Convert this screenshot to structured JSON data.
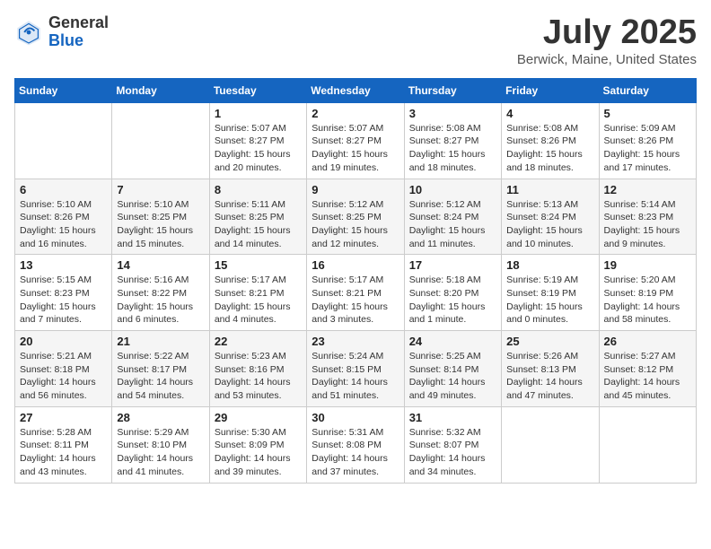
{
  "header": {
    "logo_general": "General",
    "logo_blue": "Blue",
    "title": "July 2025",
    "subtitle": "Berwick, Maine, United States"
  },
  "weekdays": [
    "Sunday",
    "Monday",
    "Tuesday",
    "Wednesday",
    "Thursday",
    "Friday",
    "Saturday"
  ],
  "weeks": [
    [
      {
        "day": "",
        "info": ""
      },
      {
        "day": "",
        "info": ""
      },
      {
        "day": "1",
        "info": "Sunrise: 5:07 AM\nSunset: 8:27 PM\nDaylight: 15 hours and 20 minutes."
      },
      {
        "day": "2",
        "info": "Sunrise: 5:07 AM\nSunset: 8:27 PM\nDaylight: 15 hours and 19 minutes."
      },
      {
        "day": "3",
        "info": "Sunrise: 5:08 AM\nSunset: 8:27 PM\nDaylight: 15 hours and 18 minutes."
      },
      {
        "day": "4",
        "info": "Sunrise: 5:08 AM\nSunset: 8:26 PM\nDaylight: 15 hours and 18 minutes."
      },
      {
        "day": "5",
        "info": "Sunrise: 5:09 AM\nSunset: 8:26 PM\nDaylight: 15 hours and 17 minutes."
      }
    ],
    [
      {
        "day": "6",
        "info": "Sunrise: 5:10 AM\nSunset: 8:26 PM\nDaylight: 15 hours and 16 minutes."
      },
      {
        "day": "7",
        "info": "Sunrise: 5:10 AM\nSunset: 8:25 PM\nDaylight: 15 hours and 15 minutes."
      },
      {
        "day": "8",
        "info": "Sunrise: 5:11 AM\nSunset: 8:25 PM\nDaylight: 15 hours and 14 minutes."
      },
      {
        "day": "9",
        "info": "Sunrise: 5:12 AM\nSunset: 8:25 PM\nDaylight: 15 hours and 12 minutes."
      },
      {
        "day": "10",
        "info": "Sunrise: 5:12 AM\nSunset: 8:24 PM\nDaylight: 15 hours and 11 minutes."
      },
      {
        "day": "11",
        "info": "Sunrise: 5:13 AM\nSunset: 8:24 PM\nDaylight: 15 hours and 10 minutes."
      },
      {
        "day": "12",
        "info": "Sunrise: 5:14 AM\nSunset: 8:23 PM\nDaylight: 15 hours and 9 minutes."
      }
    ],
    [
      {
        "day": "13",
        "info": "Sunrise: 5:15 AM\nSunset: 8:23 PM\nDaylight: 15 hours and 7 minutes."
      },
      {
        "day": "14",
        "info": "Sunrise: 5:16 AM\nSunset: 8:22 PM\nDaylight: 15 hours and 6 minutes."
      },
      {
        "day": "15",
        "info": "Sunrise: 5:17 AM\nSunset: 8:21 PM\nDaylight: 15 hours and 4 minutes."
      },
      {
        "day": "16",
        "info": "Sunrise: 5:17 AM\nSunset: 8:21 PM\nDaylight: 15 hours and 3 minutes."
      },
      {
        "day": "17",
        "info": "Sunrise: 5:18 AM\nSunset: 8:20 PM\nDaylight: 15 hours and 1 minute."
      },
      {
        "day": "18",
        "info": "Sunrise: 5:19 AM\nSunset: 8:19 PM\nDaylight: 15 hours and 0 minutes."
      },
      {
        "day": "19",
        "info": "Sunrise: 5:20 AM\nSunset: 8:19 PM\nDaylight: 14 hours and 58 minutes."
      }
    ],
    [
      {
        "day": "20",
        "info": "Sunrise: 5:21 AM\nSunset: 8:18 PM\nDaylight: 14 hours and 56 minutes."
      },
      {
        "day": "21",
        "info": "Sunrise: 5:22 AM\nSunset: 8:17 PM\nDaylight: 14 hours and 54 minutes."
      },
      {
        "day": "22",
        "info": "Sunrise: 5:23 AM\nSunset: 8:16 PM\nDaylight: 14 hours and 53 minutes."
      },
      {
        "day": "23",
        "info": "Sunrise: 5:24 AM\nSunset: 8:15 PM\nDaylight: 14 hours and 51 minutes."
      },
      {
        "day": "24",
        "info": "Sunrise: 5:25 AM\nSunset: 8:14 PM\nDaylight: 14 hours and 49 minutes."
      },
      {
        "day": "25",
        "info": "Sunrise: 5:26 AM\nSunset: 8:13 PM\nDaylight: 14 hours and 47 minutes."
      },
      {
        "day": "26",
        "info": "Sunrise: 5:27 AM\nSunset: 8:12 PM\nDaylight: 14 hours and 45 minutes."
      }
    ],
    [
      {
        "day": "27",
        "info": "Sunrise: 5:28 AM\nSunset: 8:11 PM\nDaylight: 14 hours and 43 minutes."
      },
      {
        "day": "28",
        "info": "Sunrise: 5:29 AM\nSunset: 8:10 PM\nDaylight: 14 hours and 41 minutes."
      },
      {
        "day": "29",
        "info": "Sunrise: 5:30 AM\nSunset: 8:09 PM\nDaylight: 14 hours and 39 minutes."
      },
      {
        "day": "30",
        "info": "Sunrise: 5:31 AM\nSunset: 8:08 PM\nDaylight: 14 hours and 37 minutes."
      },
      {
        "day": "31",
        "info": "Sunrise: 5:32 AM\nSunset: 8:07 PM\nDaylight: 14 hours and 34 minutes."
      },
      {
        "day": "",
        "info": ""
      },
      {
        "day": "",
        "info": ""
      }
    ]
  ]
}
